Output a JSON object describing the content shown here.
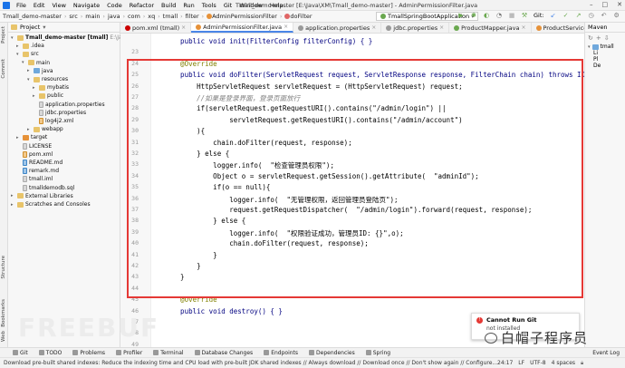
{
  "titlebar": {
    "menu": [
      "File",
      "Edit",
      "View",
      "Navigate",
      "Code",
      "Refactor",
      "Build",
      "Run",
      "Tools",
      "Git",
      "Window",
      "Help"
    ],
    "title": "Tmall_demo-master [E:\\Java\\XM\\Tmall_demo-master] - AdminPermissionFilter.java"
  },
  "breadcrumb": [
    "Tmall_demo-master",
    "src",
    "main",
    "java",
    "com",
    "xq",
    "tmall",
    "filter",
    "AdminPermissionFilter",
    "doFilter"
  ],
  "run_config": "TmallSpringBootApplication",
  "git_label": "Git:",
  "left_stripe": {
    "project": "Project",
    "commit": "Commit",
    "structure": "Structure",
    "bookmarks": "Bookmarks",
    "web": "Web"
  },
  "project_panel": {
    "header": "Project",
    "tree": [
      {
        "label": "Tmall_demo-master [tmall]",
        "extra": "E:\\Java\\X",
        "depth": 0,
        "icon": "folder",
        "open": true
      },
      {
        "label": ".idea",
        "depth": 1,
        "icon": "folder",
        "open": false
      },
      {
        "label": "src",
        "depth": 1,
        "icon": "folder",
        "open": true
      },
      {
        "label": "main",
        "depth": 2,
        "icon": "folder",
        "open": true
      },
      {
        "label": "java",
        "depth": 3,
        "icon": "folder-blue",
        "open": false
      },
      {
        "label": "resources",
        "depth": 3,
        "icon": "folder",
        "open": true
      },
      {
        "label": "mybatis",
        "depth": 4,
        "icon": "folder",
        "open": false
      },
      {
        "label": "public",
        "depth": 4,
        "icon": "folder",
        "open": false
      },
      {
        "label": "application.properties",
        "depth": 4,
        "icon": "file",
        "open": null
      },
      {
        "label": "jdbc.properties",
        "depth": 4,
        "icon": "file",
        "open": null
      },
      {
        "label": "log4j2.xml",
        "depth": 4,
        "icon": "file-xml",
        "open": null
      },
      {
        "label": "webapp",
        "depth": 3,
        "icon": "folder",
        "open": false
      },
      {
        "label": "target",
        "depth": 1,
        "icon": "folder-orange",
        "open": false
      },
      {
        "label": "LICENSE",
        "depth": 1,
        "icon": "file",
        "open": null
      },
      {
        "label": "pom.xml",
        "depth": 1,
        "icon": "file-xml",
        "open": null
      },
      {
        "label": "README.md",
        "depth": 1,
        "icon": "file-md",
        "open": null
      },
      {
        "label": "remark.md",
        "depth": 1,
        "icon": "file-md",
        "open": null
      },
      {
        "label": "tmall.iml",
        "depth": 1,
        "icon": "file",
        "open": null
      },
      {
        "label": "tmalldemodb.sql",
        "depth": 1,
        "icon": "file",
        "open": null
      },
      {
        "label": "External Libraries",
        "depth": 0,
        "icon": "folder",
        "open": false
      },
      {
        "label": "Scratches and Consoles",
        "depth": 0,
        "icon": "folder",
        "open": false
      }
    ]
  },
  "tabs": [
    {
      "label": "pom.xml (tmall)",
      "icon": "m",
      "active": false
    },
    {
      "label": "AdminPermissionFilter.java",
      "icon": "c",
      "active": true
    },
    {
      "label": "application.properties",
      "icon": "p",
      "active": false
    },
    {
      "label": "jdbc.properties",
      "icon": "p",
      "active": false
    },
    {
      "label": "ProductMapper.java",
      "icon": "i",
      "active": false
    },
    {
      "label": "ProductServiceImpl.java",
      "icon": "c",
      "active": false
    }
  ],
  "editor": {
    "line_numbers": [
      "",
      "23",
      "24",
      "25",
      "26",
      "27",
      "28",
      "29",
      "30",
      "31",
      "32",
      "33",
      "34",
      "35",
      "36",
      "37",
      "38",
      "39",
      "40",
      "41",
      "42",
      "43",
      "44",
      "45",
      "46",
      "47",
      "48",
      "49"
    ],
    "lines": [
      "    public void init(FilterConfig filterConfig) { }",
      "",
      "    @Override",
      "    public void doFilter(ServletRequest request, ServletResponse response, FilterChain chain) throws IOExce",
      "        HttpServletRequest servletRequest = (HttpServletRequest) request;",
      "        //如果是登录界面，登录页面放行",
      "        if(servletRequest.getRequestURI().contains(\"/admin/login\") ||",
      "                servletRequest.getRequestURI().contains(\"/admin/account\")",
      "        ){",
      "            chain.doFilter(request, response);",
      "        } else {",
      "            logger.info(  \"检查管理员权限\");",
      "            Object o = servletRequest.getSession().getAttribute(  \"adminId\");",
      "            if(o == null){",
      "                logger.info(  \"无管理权限，返回管理员登陆页\");",
      "                request.getRequestDispatcher(  \"/admin/login\").forward(request, response);",
      "            } else {",
      "                logger.info(  \"权限验证成功，管理员ID: {}\",o);",
      "                chain.doFilter(request, response);",
      "            }",
      "        }",
      "    }",
      "",
      "    @Override",
      "    public void destroy() { }",
      "",
      ""
    ]
  },
  "right_panel": {
    "title": "Maven",
    "project": "tmall",
    "items": [
      "Li",
      "Pl",
      "De"
    ]
  },
  "notification": {
    "title": "Cannot Run Git",
    "body": "not installed"
  },
  "watermark_text": "白帽子程序员",
  "bg_watermark": "FREEBUF",
  "bottom_tools": [
    "Git",
    "TODO",
    "Problems",
    "Profiler",
    "Terminal",
    "Database Changes",
    "Endpoints",
    "Dependencies",
    "Spring"
  ],
  "event_log": "Event Log",
  "status": {
    "message": "Download pre-built shared indexes: Reduce the indexing time and CPU load with pre-built JDK shared indexes // Always download // Download once // Don't show again // Configure... (56 minutes ago)",
    "position": "24:17",
    "line_sep": "LF",
    "encoding": "UTF-8",
    "indent": "4 spaces"
  },
  "accent_color": "#4a86e8",
  "highlight_color": "#e53935"
}
